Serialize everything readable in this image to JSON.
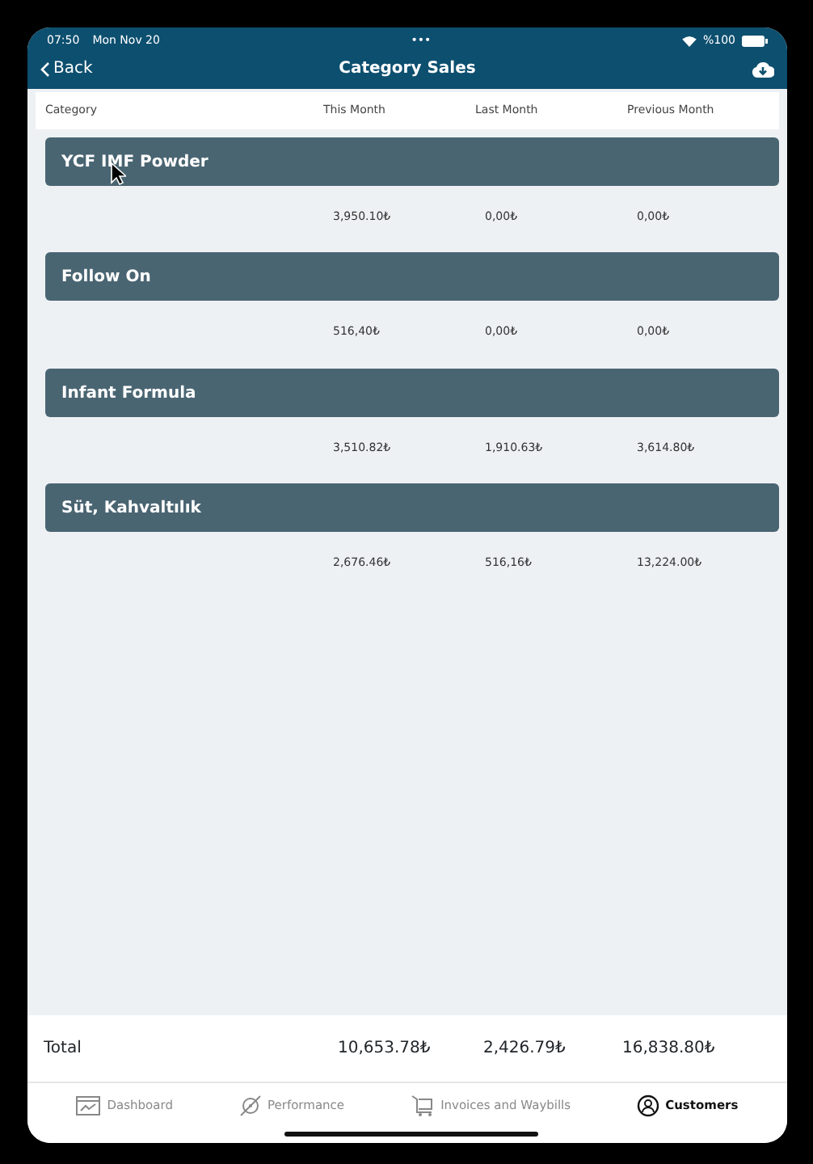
{
  "status_bar": {
    "time": "07:50",
    "date": "Mon Nov 20",
    "dots": "•••",
    "battery": "%100"
  },
  "nav_bar": {
    "back": "Back",
    "title": "Category Sales"
  },
  "columns": [
    "Category",
    "This Month",
    "Last Month",
    "Previous Month"
  ],
  "categories": [
    {
      "name": "YCF IMF Powder",
      "values": [
        "3,950.10₺",
        "0,00₺",
        "0,00₺"
      ]
    },
    {
      "name": "Follow On",
      "values": [
        "516,40₺",
        "0,00₺",
        "0,00₺"
      ]
    },
    {
      "name": "Infant Formula",
      "values": [
        "3,510.82₺",
        "1,910.63₺",
        "3,614.80₺"
      ]
    },
    {
      "name": "Süt, Kahvaltılık",
      "values": [
        "2,676.46₺",
        "516,16₺",
        "13,224.00₺"
      ]
    }
  ],
  "total": {
    "label": "Total",
    "values": [
      "10,653.78₺",
      "2,426.79₺",
      "16,838.80₺"
    ]
  },
  "tab_bar": [
    {
      "label": "Dashboard",
      "kind": "dashboard",
      "selected": false
    },
    {
      "label": "Performance",
      "kind": "performance",
      "selected": false
    },
    {
      "label": "Invoices and Waybills",
      "kind": "invoices",
      "selected": false
    },
    {
      "label": "Customers",
      "kind": "customers",
      "selected": true
    }
  ]
}
